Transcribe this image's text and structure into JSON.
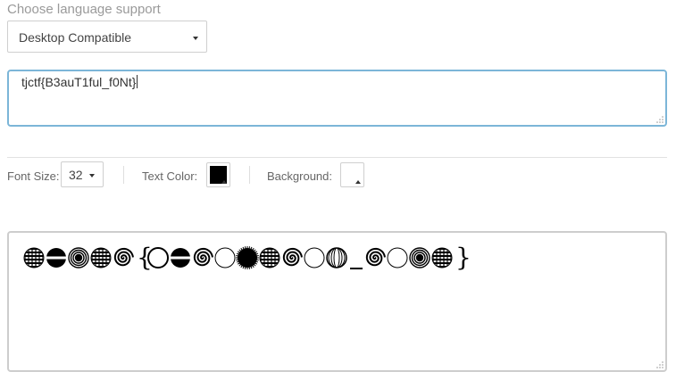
{
  "language": {
    "label": "Choose language support",
    "selected": "Desktop Compatible"
  },
  "input": {
    "value": "tjctf{B3auT1ful_f0Nt}"
  },
  "toolbar": {
    "font_size_label": "Font Size:",
    "font_size_value": "32",
    "text_color_label": "Text Color:",
    "text_color": "#000000",
    "background_label": "Background:",
    "background_color": "#ffffff"
  },
  "preview": {
    "text": "tjctf{B3auT1ful_f0Nt}",
    "glyph_style": "circular-pattern-dingbats",
    "glyph_color": "#000000"
  }
}
